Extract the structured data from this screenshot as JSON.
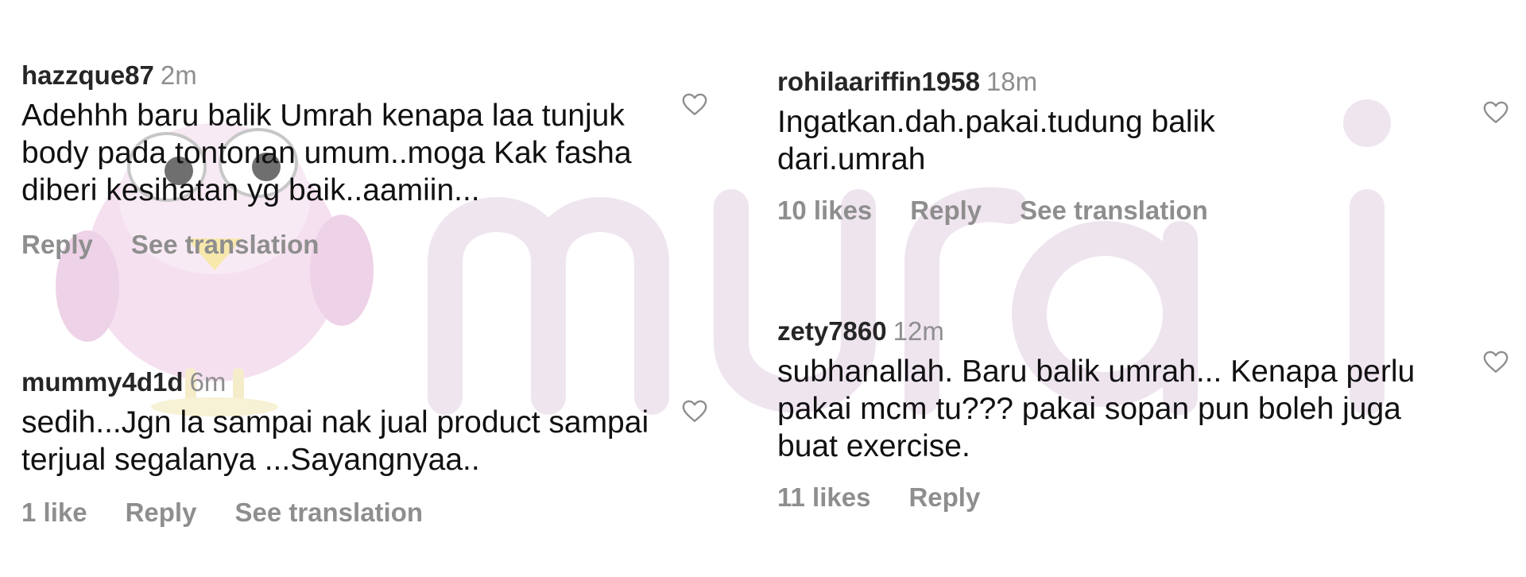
{
  "watermark": {
    "text": "murai",
    "color": "#e6d6e6",
    "mascot_icon": "bird-mascot-icon"
  },
  "comments_left": [
    {
      "username": "hazzque87",
      "time": "2m",
      "text": "Adehhh baru balik Umrah kenapa laa tunjuk body pada tontonan umum..moga Kak fasha diberi kesihatan yg baik..aamiin...",
      "reply_label": "Reply",
      "translate_label": "See translation",
      "like_icon": "heart-icon"
    },
    {
      "username": "mummy4d1d",
      "time": "6m",
      "text": "sedih...Jgn la sampai nak jual product sampai terjual segalanya ...Sayangnyaa..",
      "likes": "1 like",
      "reply_label": "Reply",
      "translate_label": "See translation",
      "like_icon": "heart-icon"
    }
  ],
  "comments_right": [
    {
      "username": "rohilaariffin1958",
      "time": "18m",
      "text": "Ingatkan.dah.pakai.tudung balik dari.umrah",
      "likes": "10 likes",
      "reply_label": "Reply",
      "translate_label": "See translation",
      "like_icon": "heart-icon"
    },
    {
      "username": "zety7860",
      "time": "12m",
      "text": "subhanallah. Baru balik umrah... Kenapa perlu pakai mcm tu??? pakai sopan pun boleh juga buat exercise.",
      "likes": "11 likes",
      "reply_label": "Reply",
      "like_icon": "heart-icon"
    }
  ]
}
